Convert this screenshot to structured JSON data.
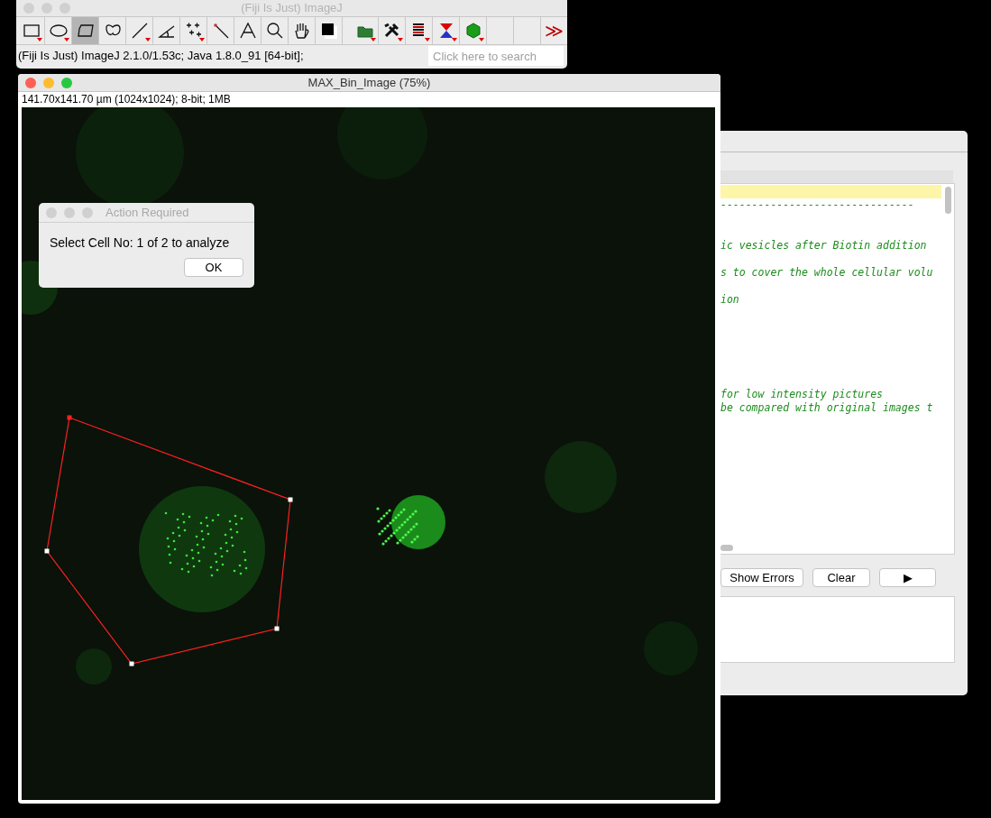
{
  "toolbar_window": {
    "title": "(Fiji Is Just) ImageJ",
    "active": false,
    "tools": [
      {
        "kind": "rectangle",
        "selected": false,
        "menu": true
      },
      {
        "kind": "oval",
        "selected": false,
        "menu": true
      },
      {
        "kind": "polygon",
        "selected": true,
        "menu": false
      },
      {
        "kind": "freehand",
        "selected": false,
        "menu": false
      },
      {
        "kind": "line",
        "selected": false,
        "menu": true
      },
      {
        "kind": "angle",
        "selected": false,
        "menu": false
      },
      {
        "kind": "multipoint",
        "selected": false,
        "menu": true
      },
      {
        "kind": "wand",
        "selected": false,
        "menu": false
      },
      {
        "kind": "text",
        "selected": false,
        "menu": false
      },
      {
        "kind": "zoom",
        "selected": false,
        "menu": false
      },
      {
        "kind": "hand",
        "selected": false,
        "menu": false
      },
      {
        "kind": "color",
        "selected": false,
        "menu": false
      }
    ],
    "extra_tools": [
      {
        "kind": "folder",
        "menu": true
      },
      {
        "kind": "tools",
        "menu": true
      },
      {
        "kind": "stack",
        "menu": true
      },
      {
        "kind": "lut",
        "menu": true
      },
      {
        "kind": "polyhedron",
        "menu": true
      },
      {
        "kind": "empty",
        "menu": false
      },
      {
        "kind": "empty",
        "menu": false
      }
    ],
    "more_label": "≫",
    "status": "(Fiji Is Just) ImageJ 2.1.0/1.53c; Java 1.8.0_91 [64-bit];",
    "search": {
      "placeholder": "Click here to search"
    }
  },
  "editor_window": {
    "lines": [
      {
        "kind": "current"
      },
      {
        "kind": "code",
        "text": "-------------------------------"
      },
      {
        "kind": "blank"
      },
      {
        "kind": "blank"
      },
      {
        "kind": "code",
        "text": "ic vesicles after Biotin addition"
      },
      {
        "kind": "blank"
      },
      {
        "kind": "code",
        "text": "s to cover the whole cellular volu"
      },
      {
        "kind": "blank"
      },
      {
        "kind": "code",
        "text": "ion"
      },
      {
        "kind": "blank"
      },
      {
        "kind": "blank"
      },
      {
        "kind": "blank"
      },
      {
        "kind": "blank"
      },
      {
        "kind": "blank"
      },
      {
        "kind": "blank"
      },
      {
        "kind": "code",
        "text": "for low intensity pictures"
      },
      {
        "kind": "code",
        "text": "be compared with original images t"
      }
    ],
    "buttons": [
      "Show Errors",
      "Clear",
      "▶"
    ]
  },
  "image_window": {
    "title": "MAX_Bin_Image (75%)",
    "active": true,
    "info": "141.70x141.70 µm (1024x1024); 8-bit; 1MB"
  },
  "dialog": {
    "title": "Action Required",
    "active": false,
    "message": "Select Cell No: 1 of 2 to analyze",
    "button": "OK"
  }
}
